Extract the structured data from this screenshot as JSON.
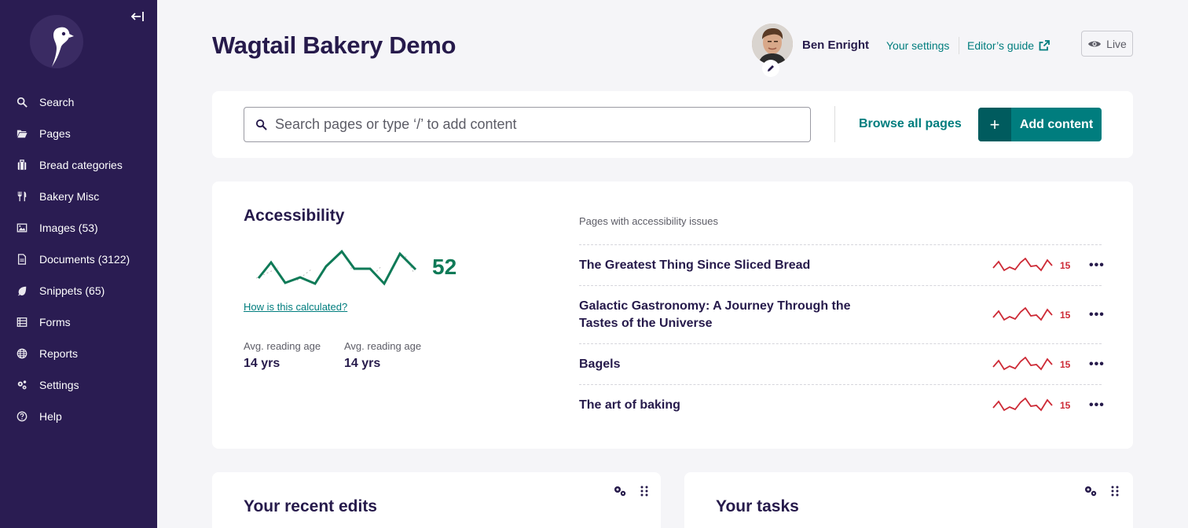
{
  "sidebar": {
    "collapse_icon": "collapse-left-icon",
    "items": [
      {
        "label": "Search",
        "icon": "search-icon"
      },
      {
        "label": "Pages",
        "icon": "folder-open-icon"
      },
      {
        "label": "Bread categories",
        "icon": "suitcase-icon"
      },
      {
        "label": "Bakery Misc",
        "icon": "utensils-icon"
      },
      {
        "label": "Images (53)",
        "icon": "image-icon"
      },
      {
        "label": "Documents (3122)",
        "icon": "doc-icon"
      },
      {
        "label": "Snippets (65)",
        "icon": "snippet-icon"
      },
      {
        "label": "Forms",
        "icon": "list-icon"
      },
      {
        "label": "Reports",
        "icon": "globe-icon"
      },
      {
        "label": "Settings",
        "icon": "cogs-icon"
      },
      {
        "label": "Help",
        "icon": "help-icon"
      }
    ]
  },
  "header": {
    "title": "Wagtail Bakery Demo",
    "user_name": "Ben Enright",
    "settings_link": "Your settings",
    "guide_link": "Editor’s guide",
    "live_label": "Live"
  },
  "search": {
    "placeholder": "Search pages or type ‘/’ to add content",
    "browse_label": "Browse all pages",
    "add_label": "Add content"
  },
  "accessibility": {
    "title": "Accessibility",
    "score": "52",
    "calc_link": "How is this calculated?",
    "stats": [
      {
        "label": "Avg. reading age",
        "value": "14 yrs"
      },
      {
        "label": "Avg. reading age",
        "value": "14 yrs"
      }
    ],
    "issues_label": "Pages with accessibility issues",
    "issues": [
      {
        "title": "The Greatest Thing Since Sliced Bread",
        "count": "15"
      },
      {
        "title": "Galactic Gastronomy: A Journey Through the Tastes of the Universe",
        "count": "15"
      },
      {
        "title": "Bagels",
        "count": "15"
      },
      {
        "title": "The art of baking",
        "count": "15"
      }
    ]
  },
  "panels": {
    "recent_edits": "Your recent edits",
    "tasks": "Your tasks"
  },
  "colors": {
    "sidebar_bg": "#2a1c52",
    "accent_teal": "#007d7e",
    "score_green": "#0f7a57",
    "issue_red": "#cd2a36"
  }
}
